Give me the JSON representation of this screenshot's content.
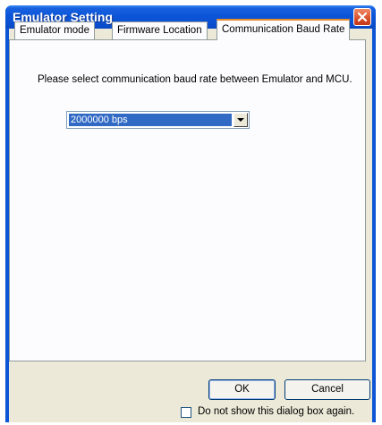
{
  "window": {
    "title": "Emulator Setting"
  },
  "tabs": [
    {
      "label": "Emulator mode",
      "active": false
    },
    {
      "label": "Firmware Location",
      "active": false
    },
    {
      "label": "Communication Baud Rate",
      "active": true
    }
  ],
  "panel": {
    "prompt": "Please select communication baud rate between Emulator and MCU.",
    "baud_rate": {
      "selected": "2000000 bps"
    }
  },
  "buttons": {
    "ok": "OK",
    "cancel": "Cancel"
  },
  "footer": {
    "checkbox_label": "Do not show this dialog box again.",
    "checked": false
  },
  "colors": {
    "title_bar": "#0c55d8",
    "dialog_bg": "#ece9d8",
    "tab_highlight": "#e68b2c",
    "selection": "#316ac5"
  },
  "icons": {
    "close": "close-icon",
    "dropdown": "chevron-down-icon"
  }
}
